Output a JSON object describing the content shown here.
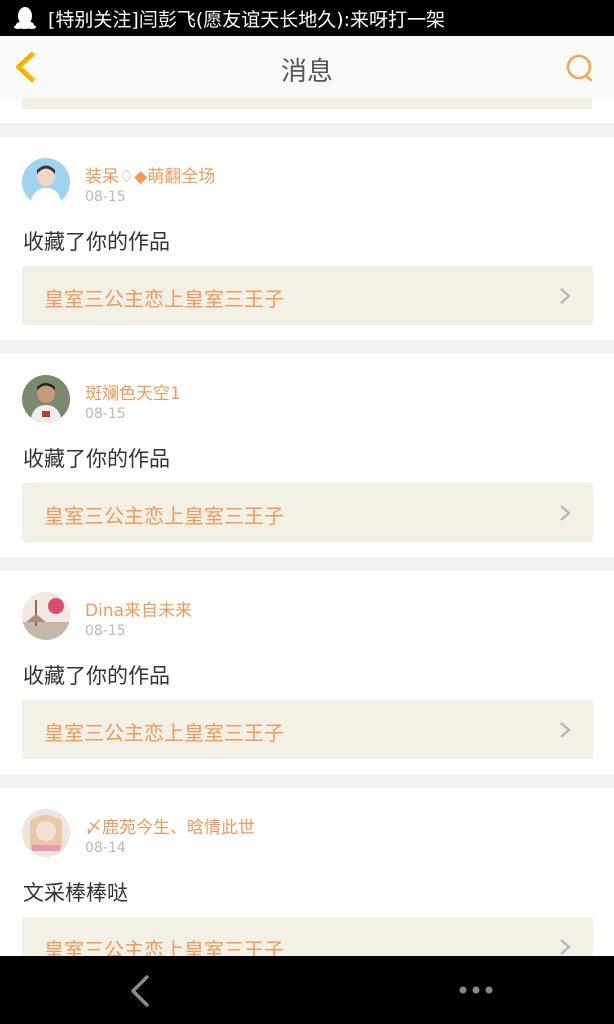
{
  "status_bar": {
    "notification_text": "[特别关注]闫彭飞(愿友谊天长地久):来呀打一架"
  },
  "header": {
    "title": "消息"
  },
  "messages": [
    {
      "name": "装呆♢◆萌翻全场",
      "date": "08-15",
      "action": "收藏了你的作品",
      "work_title": "皇室三公主恋上皇室三王子",
      "avatar": "avatar-boy-blue"
    },
    {
      "name": "斑斓色天空1",
      "date": "08-15",
      "action": "收藏了你的作品",
      "work_title": "皇室三公主恋上皇室三王子",
      "avatar": "avatar-boy-photo"
    },
    {
      "name": "Dina来自未来",
      "date": "08-15",
      "action": "收藏了你的作品",
      "work_title": "皇室三公主恋上皇室三王子",
      "avatar": "avatar-scene"
    },
    {
      "name": "〆鹿苑今生、晗情此世",
      "date": "08-14",
      "action": "文采棒棒哒",
      "work_title": "皇室三公主恋上皇室三王子",
      "avatar": "avatar-girl"
    }
  ],
  "colors": {
    "accent": "#f29a5c",
    "work_bg": "#f3f1e6"
  },
  "icons": [
    "qq-penguin-icon",
    "back-arrow-icon",
    "search-icon",
    "chevron-right-icon",
    "nav-back-icon",
    "more-dots-icon"
  ]
}
